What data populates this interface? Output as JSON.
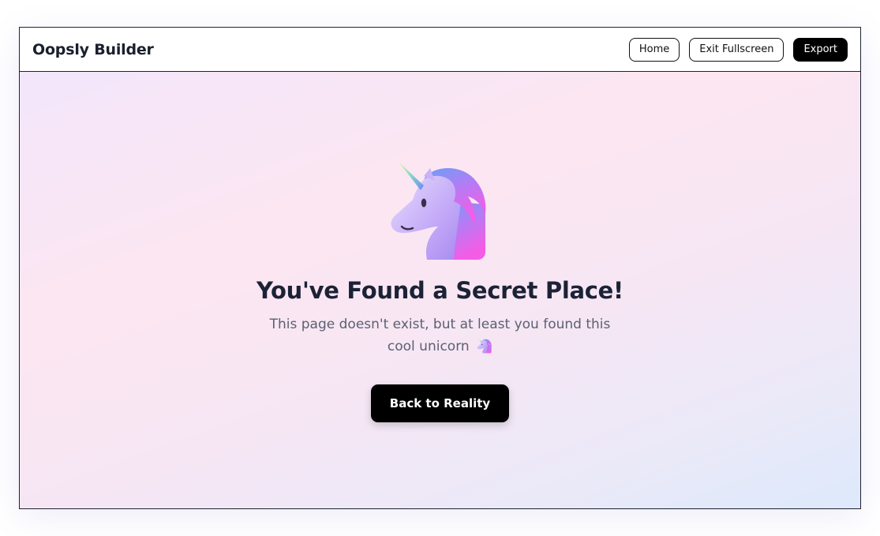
{
  "header": {
    "brand": "Oopsly Builder",
    "nav": {
      "home_label": "Home",
      "fullscreen_label": "Exit Fullscreen",
      "export_label": "Export"
    }
  },
  "main": {
    "illustration_icon": "unicorn-icon",
    "headline": "You've Found a Secret Place!",
    "message": "This page doesn't exist, but at least you found this cool unicorn",
    "cta_label": "Back to Reality"
  },
  "colors": {
    "primary_button": "#000000",
    "heading": "#1c2236",
    "body_text": "#5a6172",
    "background_gradient": [
      "#f3e6fb",
      "#fce6f1",
      "#dde9fb"
    ]
  }
}
